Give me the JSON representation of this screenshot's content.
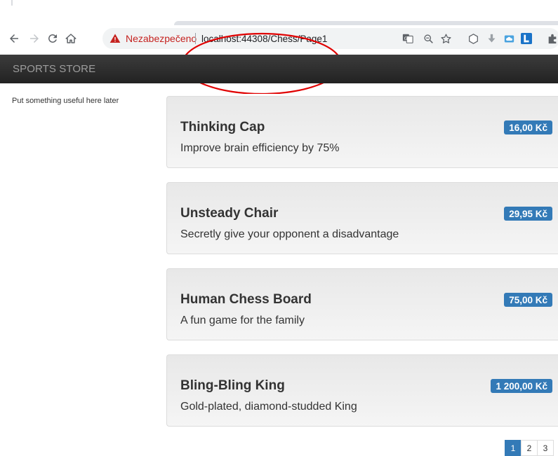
{
  "browser": {
    "security_label": "Nezabezpečeno",
    "url": "localhost:44308/Chess/Page1",
    "nav_icons": [
      "back-arrow-icon",
      "forward-arrow-icon",
      "reload-icon",
      "home-icon"
    ],
    "omnibox_icons": [
      "translate-icon",
      "zoom-icon",
      "bookmark-star-icon"
    ],
    "extension_icons": [
      "shield-extension-icon",
      "download-extension-icon",
      "cloud-extension-icon",
      "l-extension-icon",
      "puzzle-extension-icon"
    ]
  },
  "navbar": {
    "brand": "SPORTS STORE"
  },
  "sidebar": {
    "note": "Put something useful here later"
  },
  "products": [
    {
      "name": "Thinking Cap",
      "price": "16,00 Kč",
      "description": "Improve brain efficiency by 75%"
    },
    {
      "name": "Unsteady Chair",
      "price": "29,95 Kč",
      "description": "Secretly give your opponent a disadvantage"
    },
    {
      "name": "Human Chess Board",
      "price": "75,00 Kč",
      "description": "A fun game for the family"
    },
    {
      "name": "Bling-Bling King",
      "price": "1 200,00 Kč",
      "description": "Gold-plated, diamond-studded King"
    }
  ],
  "pagination": {
    "pages": [
      "1",
      "2",
      "3"
    ],
    "current": "1"
  },
  "colors": {
    "accent": "#337ab7",
    "navbar": "#222222",
    "annotation": "#e00000",
    "insecure": "#c5221f"
  }
}
